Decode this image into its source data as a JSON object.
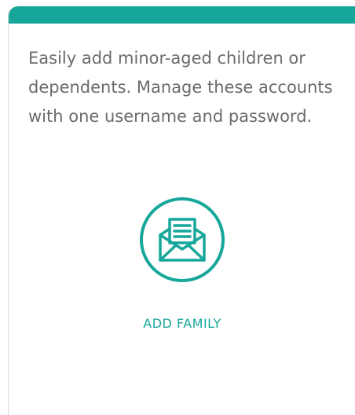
{
  "card": {
    "description": "Easily add minor-aged children or dependents. Manage these accounts with one username and password.",
    "action": {
      "label": "ADD FAMILY",
      "icon": "envelope-letter-icon"
    }
  },
  "colors": {
    "accent": "#17a79a",
    "text": "#6b6b6b",
    "border": "#d9d9d9"
  }
}
